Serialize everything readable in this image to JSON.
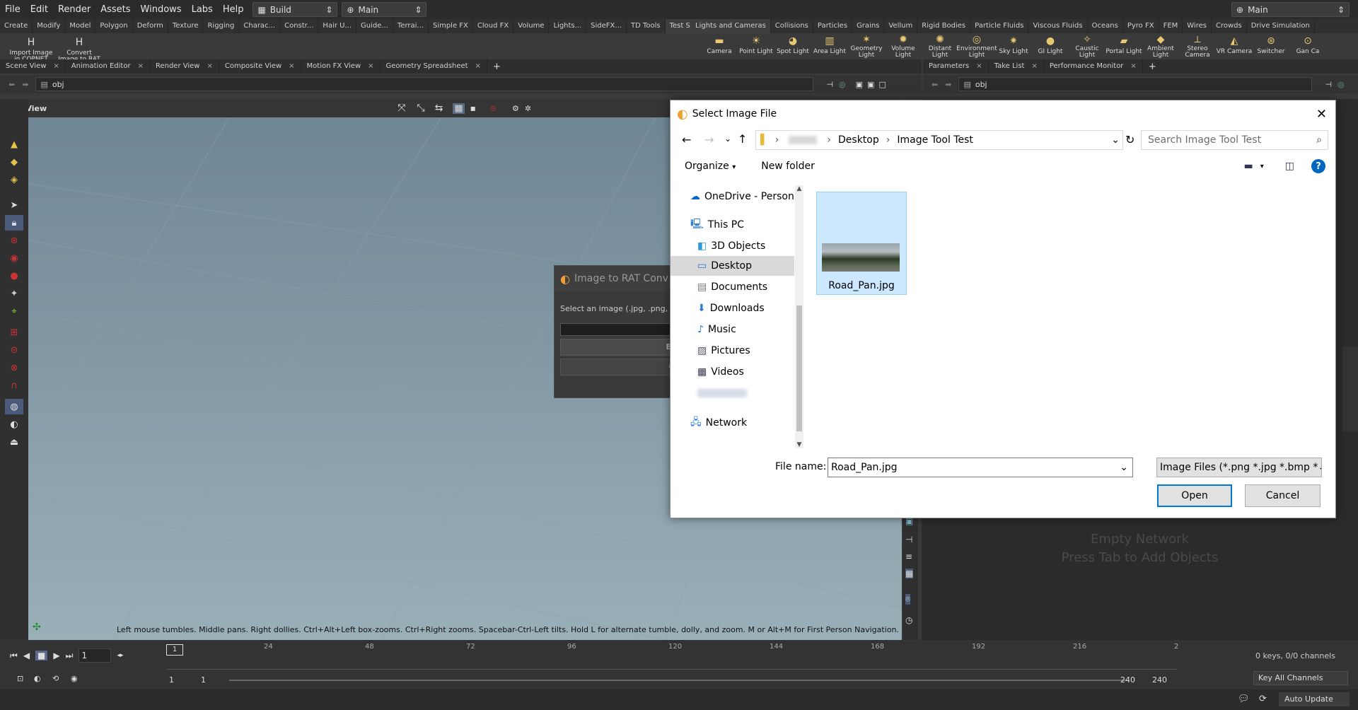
{
  "menu": [
    "File",
    "Edit",
    "Render",
    "Assets",
    "Windows",
    "Labs",
    "Help"
  ],
  "desktop": {
    "build": "Build",
    "main": "Main",
    "main_right": "Main"
  },
  "shelf_tabs_left": [
    "Create",
    "Modify",
    "Model",
    "Polygon",
    "Deform",
    "Texture",
    "Rigging",
    "Charac...",
    "Constr...",
    "Hair U...",
    "Guide...",
    "Terrai...",
    "Simple FX",
    "Cloud FX",
    "Volume",
    "Lights...",
    "SideFX...",
    "TD Tools",
    "Test S..."
  ],
  "shelf_tabs_right": [
    "Lights and Cameras",
    "Collisions",
    "Particles",
    "Grains",
    "Vellum",
    "Rigid Bodies",
    "Particle Fluids",
    "Viscous Fluids",
    "Oceans",
    "Pyro FX",
    "FEM",
    "Wires",
    "Crowds",
    "Drive Simulation"
  ],
  "shelf_tools_left": [
    {
      "label": "Import Image in COPNET",
      "icon": "H"
    },
    {
      "label": "Convert Image to RAT",
      "icon": "H"
    }
  ],
  "shelf_tools_right": [
    {
      "label": "Camera"
    },
    {
      "label": "Point Light"
    },
    {
      "label": "Spot Light"
    },
    {
      "label": "Area Light"
    },
    {
      "label": "Geometry Light"
    },
    {
      "label": "Volume Light"
    },
    {
      "label": "Distant Light"
    },
    {
      "label": "Environment Light"
    },
    {
      "label": "Sky Light"
    },
    {
      "label": "GI Light"
    },
    {
      "label": "Caustic Light"
    },
    {
      "label": "Portal Light"
    },
    {
      "label": "Ambient Light"
    },
    {
      "label": "Stereo Camera"
    },
    {
      "label": "VR Camera"
    },
    {
      "label": "Switcher"
    },
    {
      "label": "Gan Ca"
    }
  ],
  "pane_tabs_left": [
    "Scene View",
    "Animation Editor",
    "Render View",
    "Composite View",
    "Motion FX View",
    "Geometry Spreadsheet"
  ],
  "pane_tabs_right": [
    "Parameters",
    "Take List",
    "Performance Monitor"
  ],
  "path_left": "obj",
  "path_right": "obj",
  "view_label": "View",
  "viewport_help": "Left mouse tumbles. Middle pans. Right dollies. Ctrl+Alt+Left box-zooms. Ctrl+Right zooms. Spacebar-Ctrl-Left tilts. Hold L for alternate tumble, dolly, and zoom.     M or Alt+M for First Person Navigation.",
  "network_empty": {
    "line1": "Empty Network",
    "line2": "Press Tab to Add Objects"
  },
  "rat_dialog": {
    "title": "Image to RAT Conv",
    "prompt": "Select an image (.jpg, .png, .t",
    "browse": "Brow",
    "convert": "Conv"
  },
  "file_dialog": {
    "title": "Select Image File",
    "breadcrumb": [
      "Desktop",
      "Image Tool Test"
    ],
    "search_placeholder": "Search Image Tool Test",
    "organize": "Organize",
    "new_folder": "New folder",
    "nav_items": [
      "OneDrive - Person",
      "This PC",
      "3D Objects",
      "Desktop",
      "Documents",
      "Downloads",
      "Music",
      "Pictures",
      "Videos",
      "Network"
    ],
    "selected_nav": "Desktop",
    "files": [
      {
        "name": "Road_Pan.jpg"
      }
    ],
    "file_name_label": "File name:",
    "file_name_value": "Road_Pan.jpg",
    "file_type": "Image Files (*.png *.jpg *.bmp *",
    "open": "Open",
    "cancel": "Cancel"
  },
  "timeline": {
    "ticks": [
      "24",
      "48",
      "72",
      "96",
      "120",
      "144",
      "168",
      "192",
      "216",
      "2"
    ],
    "current_frame": "1",
    "frame_marker": "1",
    "range_start": "1",
    "range_start2": "1",
    "range_end": "240",
    "range_end2": "240",
    "keys_info": "0 keys, 0/0 channels",
    "key_all": "Key All Channels",
    "auto_update": "Auto Update"
  },
  "colors": {
    "accent": "#f0a030",
    "selection": "#cce8ff",
    "win_blue": "#0067c0"
  }
}
